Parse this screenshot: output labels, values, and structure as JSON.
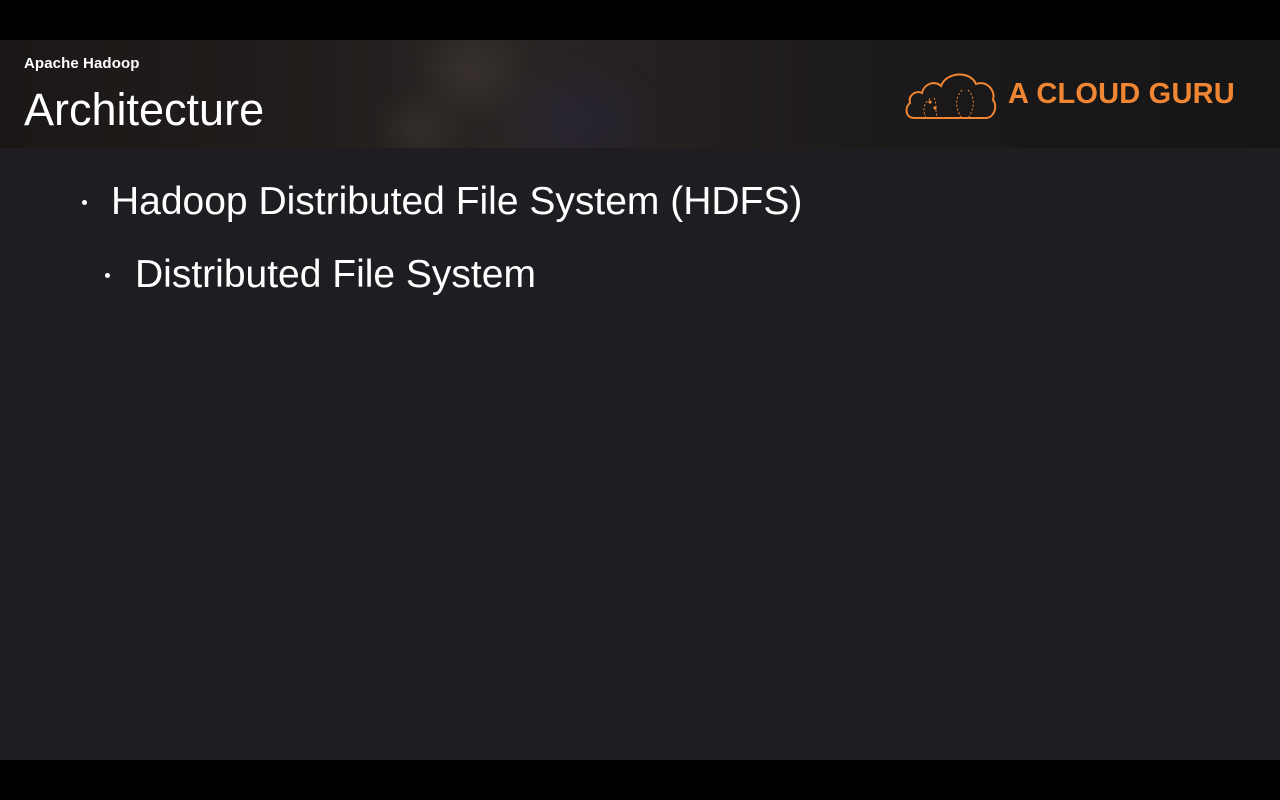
{
  "slide": {
    "section": "Apache Hadoop",
    "title": "Architecture"
  },
  "logo": {
    "brand_text": "A CLOUD GURU",
    "icon": "cloud-icon",
    "color": "#f08533"
  },
  "bullets": [
    {
      "level": 1,
      "text": "Hadoop Distributed File System (HDFS)"
    },
    {
      "level": 2,
      "text": "Distributed File System"
    }
  ],
  "colors": {
    "slide_background": "#1f1d21",
    "text": "#ffffff",
    "accent": "#f08533"
  }
}
